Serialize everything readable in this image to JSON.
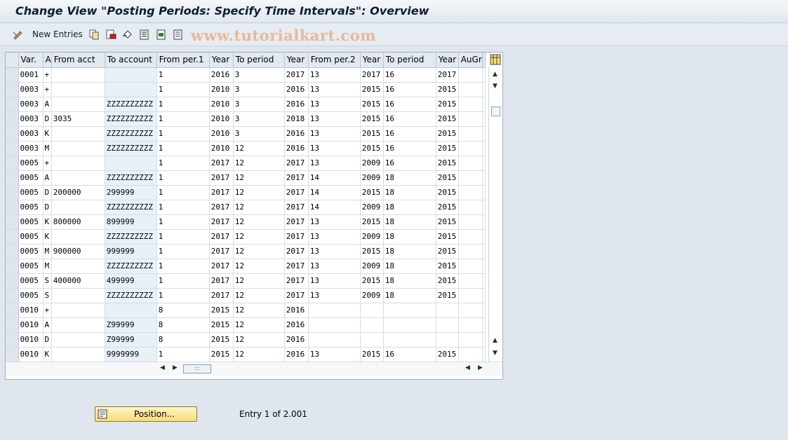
{
  "title": "Change View \"Posting Periods: Specify Time Intervals\": Overview",
  "toolbar": {
    "new_entries_label": "New Entries",
    "watermark": "www.tutorialkart.com"
  },
  "table": {
    "columns": [
      "Var.",
      "A",
      "From acct",
      "To account",
      "From per.1",
      "Year",
      "To period",
      "Year",
      "From per.2",
      "Year",
      "To period",
      "Year",
      "AuGr"
    ],
    "rows": [
      [
        "0001",
        "+",
        "",
        "",
        "1",
        "2016",
        "3",
        "2017",
        "13",
        "2017",
        "16",
        "2017",
        ""
      ],
      [
        "0003",
        "+",
        "",
        "",
        "1",
        "2010",
        "3",
        "2016",
        "13",
        "2015",
        "16",
        "2015",
        ""
      ],
      [
        "0003",
        "A",
        "",
        "ZZZZZZZZZZ",
        "1",
        "2010",
        "3",
        "2016",
        "13",
        "2015",
        "16",
        "2015",
        ""
      ],
      [
        "0003",
        "D",
        "3035",
        "ZZZZZZZZZZ",
        "1",
        "2010",
        "3",
        "2018",
        "13",
        "2015",
        "16",
        "2015",
        ""
      ],
      [
        "0003",
        "K",
        "",
        "ZZZZZZZZZZ",
        "1",
        "2010",
        "3",
        "2016",
        "13",
        "2015",
        "16",
        "2015",
        ""
      ],
      [
        "0003",
        "M",
        "",
        "ZZZZZZZZZZ",
        "1",
        "2010",
        "12",
        "2016",
        "13",
        "2015",
        "16",
        "2015",
        ""
      ],
      [
        "0005",
        "+",
        "",
        "",
        "1",
        "2017",
        "12",
        "2017",
        "13",
        "2009",
        "16",
        "2015",
        ""
      ],
      [
        "0005",
        "A",
        "",
        "ZZZZZZZZZZ",
        "1",
        "2017",
        "12",
        "2017",
        "14",
        "2009",
        "18",
        "2015",
        ""
      ],
      [
        "0005",
        "D",
        "200000",
        "299999",
        "1",
        "2017",
        "12",
        "2017",
        "14",
        "2015",
        "18",
        "2015",
        ""
      ],
      [
        "0005",
        "D",
        "",
        "ZZZZZZZZZZ",
        "1",
        "2017",
        "12",
        "2017",
        "14",
        "2009",
        "18",
        "2015",
        ""
      ],
      [
        "0005",
        "K",
        "800000",
        "899999",
        "1",
        "2017",
        "12",
        "2017",
        "13",
        "2015",
        "18",
        "2015",
        ""
      ],
      [
        "0005",
        "K",
        "",
        "ZZZZZZZZZZ",
        "1",
        "2017",
        "12",
        "2017",
        "13",
        "2009",
        "18",
        "2015",
        ""
      ],
      [
        "0005",
        "M",
        "900000",
        "999999",
        "1",
        "2017",
        "12",
        "2017",
        "13",
        "2015",
        "18",
        "2015",
        ""
      ],
      [
        "0005",
        "M",
        "",
        "ZZZZZZZZZZ",
        "1",
        "2017",
        "12",
        "2017",
        "13",
        "2009",
        "18",
        "2015",
        ""
      ],
      [
        "0005",
        "S",
        "400000",
        "499999",
        "1",
        "2017",
        "12",
        "2017",
        "13",
        "2015",
        "18",
        "2015",
        ""
      ],
      [
        "0005",
        "S",
        "",
        "ZZZZZZZZZZ",
        "1",
        "2017",
        "12",
        "2017",
        "13",
        "2009",
        "18",
        "2015",
        ""
      ],
      [
        "0010",
        "+",
        "",
        "",
        "8",
        "2015",
        "12",
        "2016",
        "",
        "",
        "",
        "",
        ""
      ],
      [
        "0010",
        "A",
        "",
        "Z99999",
        "8",
        "2015",
        "12",
        "2016",
        "",
        "",
        "",
        "",
        ""
      ],
      [
        "0010",
        "D",
        "",
        "Z99999",
        "8",
        "2015",
        "12",
        "2016",
        "",
        "",
        "",
        "",
        ""
      ],
      [
        "0010",
        "K",
        "",
        "9999999",
        "1",
        "2015",
        "12",
        "2016",
        "13",
        "2015",
        "16",
        "2015",
        ""
      ]
    ]
  },
  "footer": {
    "position_label": "Position...",
    "entry_info": "Entry 1 of 2.001"
  },
  "colors": {
    "background": "#dfe6ee",
    "button_yellow": "#f7dc7a",
    "input_cell": "#e8f0f8"
  },
  "icons": [
    "edit-icon",
    "copy-icon",
    "delete-icon",
    "undo-icon",
    "select-all-icon",
    "select-block-icon",
    "deselect-all-icon",
    "table-settings-icon",
    "position-icon"
  ]
}
